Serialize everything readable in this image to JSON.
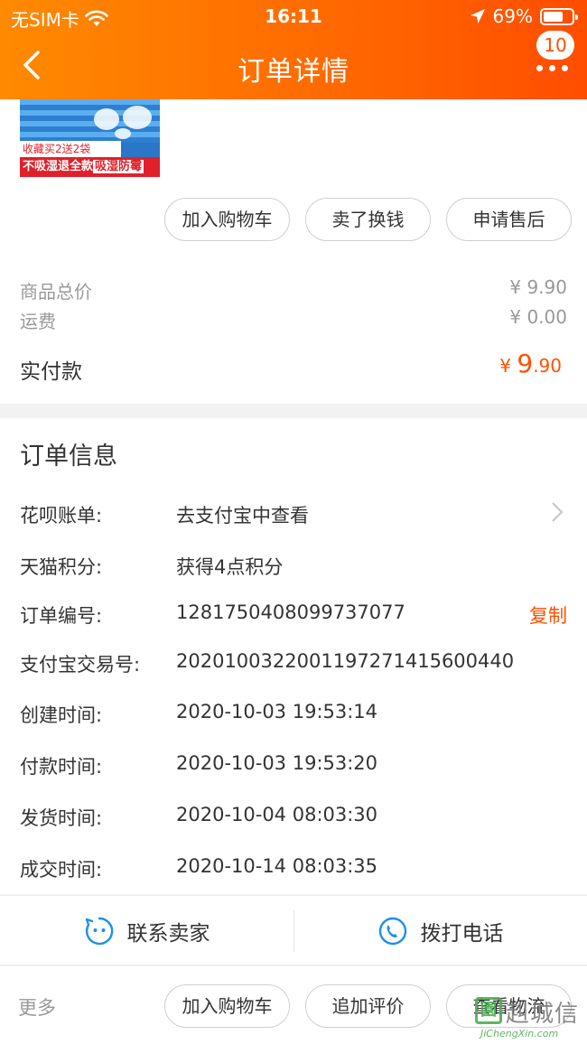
{
  "status_bar": {
    "carrier": "无SIM卡",
    "time": "16:11",
    "battery": "69%",
    "battery_level": 0.69
  },
  "nav": {
    "title": "订单详情",
    "badge_count": "10",
    "back_icon": "chevron-left-icon",
    "more_icon": "more-dots-icon"
  },
  "product": {
    "image_promo_line1": "收藏买2送2袋",
    "image_promo_line2_a": "不吸湿退全款",
    "image_promo_line2_b": "吸湿防霉"
  },
  "product_actions": [
    {
      "label": "加入购物车"
    },
    {
      "label": "卖了换钱"
    },
    {
      "label": "申请售后"
    }
  ],
  "price": {
    "subtotal_label": "商品总价",
    "subtotal_value": "¥ 9.90",
    "shipping_label": "运费",
    "shipping_value": "¥ 0.00",
    "paid_label": "实付款",
    "paid_currency": "¥ ",
    "paid_int": "9",
    "paid_dec": ".90"
  },
  "order_info": {
    "title": "订单信息",
    "rows": [
      {
        "label": "花呗账单:",
        "value": "去支付宝中查看"
      },
      {
        "label": "天猫积分:",
        "value": "获得4点积分"
      },
      {
        "label": "订单编号:",
        "value": "1281750408099737077"
      },
      {
        "label": "支付宝交易号:",
        "value": "2020100322001197271415600440"
      },
      {
        "label": "创建时间:",
        "value": "2020-10-03 19:53:14"
      },
      {
        "label": "付款时间:",
        "value": "2020-10-03 19:53:20"
      },
      {
        "label": "发货时间:",
        "value": "2020-10-04 08:03:30"
      },
      {
        "label": "成交时间:",
        "value": "2020-10-14 08:03:35"
      }
    ],
    "copy_label": "复制"
  },
  "contact": {
    "seller_label": "联系卖家",
    "phone_label": "拨打电话"
  },
  "bottom": {
    "more_label": "更多",
    "buttons": [
      {
        "label": "加入购物车"
      },
      {
        "label": "追加评价"
      },
      {
        "label": "查看物流"
      }
    ]
  },
  "watermark": {
    "logo_char": "園",
    "text": "赳城信",
    "sub": "JiChengXin.com"
  },
  "colors": {
    "accent": "#ff5000",
    "header_start": "#ff8a00",
    "header_end": "#ff4d00",
    "icon_blue": "#1e90e8"
  }
}
